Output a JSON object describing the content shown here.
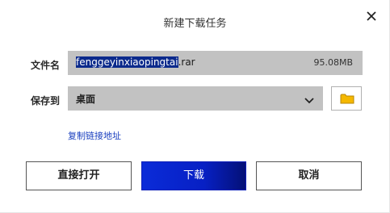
{
  "dialog": {
    "title": "新建下载任务",
    "close_icon": "close-icon"
  },
  "filename": {
    "label": "文件名",
    "selected_part": "fenggeyinxiaopingtai",
    "extension": ".rar",
    "size": "95.08MB"
  },
  "save_to": {
    "label": "保存到",
    "value": "桌面",
    "dropdown_icon": "chevron-down-icon",
    "folder_icon": "folder-icon",
    "folder_color": "#f5b800"
  },
  "copy_link": {
    "label": "复制链接地址"
  },
  "buttons": {
    "open_direct": "直接打开",
    "download": "下载",
    "cancel": "取消"
  },
  "colors": {
    "accent": "#0720c4",
    "link": "#1a3fbf",
    "field_bg": "#c2c2c2",
    "selection": "#0b2a8c"
  }
}
